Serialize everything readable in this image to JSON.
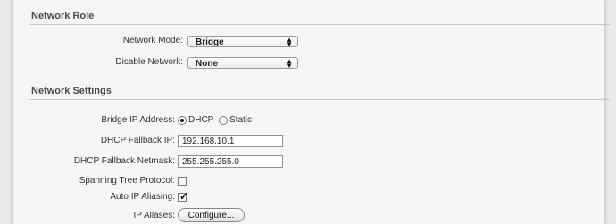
{
  "network_role": {
    "title": "Network Role",
    "network_mode": {
      "label": "Network Mode:",
      "value": "Bridge"
    },
    "disable_network": {
      "label": "Disable Network:",
      "value": "None"
    }
  },
  "network_settings": {
    "title": "Network Settings",
    "bridge_ip_address": {
      "label": "Bridge IP Address:",
      "option_dhcp": "DHCP",
      "option_static": "Static",
      "selected": "DHCP"
    },
    "dhcp_fallback_ip": {
      "label": "DHCP Fallback IP:",
      "value": "192.168.10.1"
    },
    "dhcp_fallback_netmask": {
      "label": "DHCP Fallback Netmask:",
      "value": "255.255.255.0"
    },
    "spanning_tree_protocol": {
      "label": "Spanning Tree Protocol:",
      "checked": false
    },
    "auto_ip_aliasing": {
      "label": "Auto IP Aliasing:",
      "checked": true
    },
    "ip_aliases": {
      "label": "IP Aliases:",
      "button_label": "Configure..."
    }
  }
}
